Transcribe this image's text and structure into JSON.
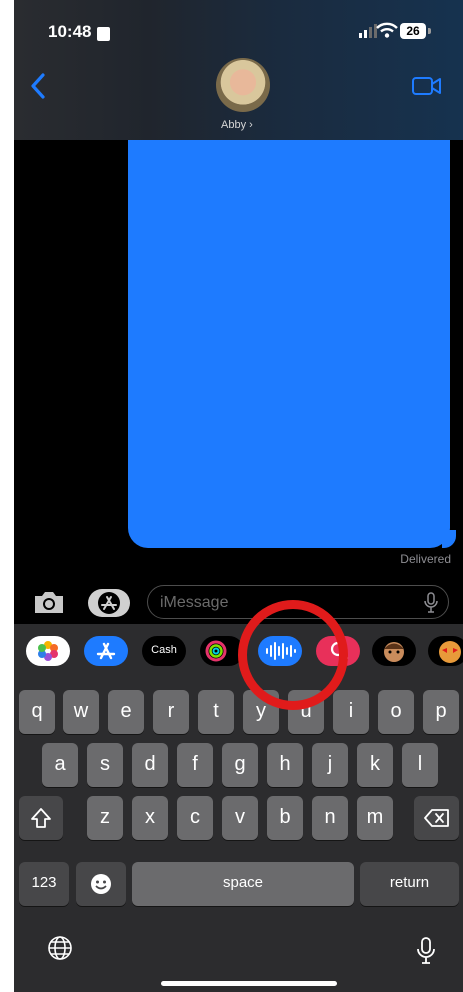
{
  "status_bar": {
    "time": "10:48",
    "battery": "26"
  },
  "header": {
    "contact_name": "Abby ›"
  },
  "conversation": {
    "delivered_label": "Delivered",
    "bubble_color": "#1e7bff"
  },
  "compose": {
    "placeholder": "iMessage"
  },
  "app_tray": {
    "apple_cash_label": "Cash"
  },
  "keyboard": {
    "row1": [
      "q",
      "w",
      "e",
      "r",
      "t",
      "y",
      "u",
      "i",
      "o",
      "p"
    ],
    "row2": [
      "a",
      "s",
      "d",
      "f",
      "g",
      "h",
      "j",
      "k",
      "l"
    ],
    "row3": [
      "z",
      "x",
      "c",
      "v",
      "b",
      "n",
      "m"
    ],
    "numbers_label": "123",
    "space_label": "space",
    "return_label": "return"
  },
  "annotation": {
    "color": "#e01b1b"
  }
}
